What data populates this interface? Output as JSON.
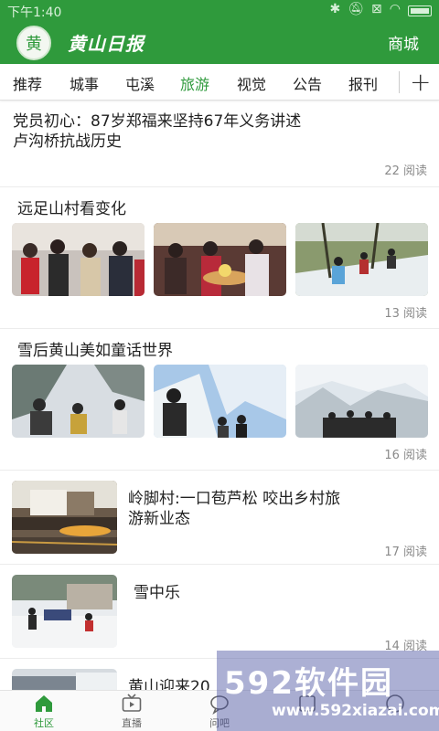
{
  "status": {
    "time": "下午1:40"
  },
  "header": {
    "logo_char": "黄",
    "logo_text": "黄山日报",
    "mall_label": "商城"
  },
  "tabs": [
    {
      "label": "推荐"
    },
    {
      "label": "城事"
    },
    {
      "label": "屯溪"
    },
    {
      "label": "旅游"
    },
    {
      "label": "视觉"
    },
    {
      "label": "公告"
    },
    {
      "label": "报刊"
    }
  ],
  "active_tab": "旅游",
  "feed": [
    {
      "title_line1": "党员初心：87岁郑福来坚持67年义务讲述",
      "title_line2": "卢沟桥抗战历史",
      "reads": "22 阅读"
    },
    {
      "title": "远足山村看变化",
      "reads": "13 阅读"
    },
    {
      "title": "雪后黄山美如童话世界",
      "reads": "16 阅读"
    },
    {
      "title_line1": "岭脚村:一口苞芦松 咬出乡村旅",
      "title_line2": "游新业态",
      "reads": "17 阅读"
    },
    {
      "title": "雪中乐",
      "reads": "14 阅读"
    },
    {
      "title": "黄山迎来20"
    }
  ],
  "bottom_nav": [
    {
      "label": "社区"
    },
    {
      "label": "直播"
    },
    {
      "label": "问吧"
    },
    {
      "label": ""
    },
    {
      "label": ""
    }
  ],
  "watermark": {
    "big": "592软件园",
    "url": "www.592xiazai.com"
  },
  "colors": {
    "brand": "#2f9a3c",
    "read_count": "#8a8a8a"
  }
}
